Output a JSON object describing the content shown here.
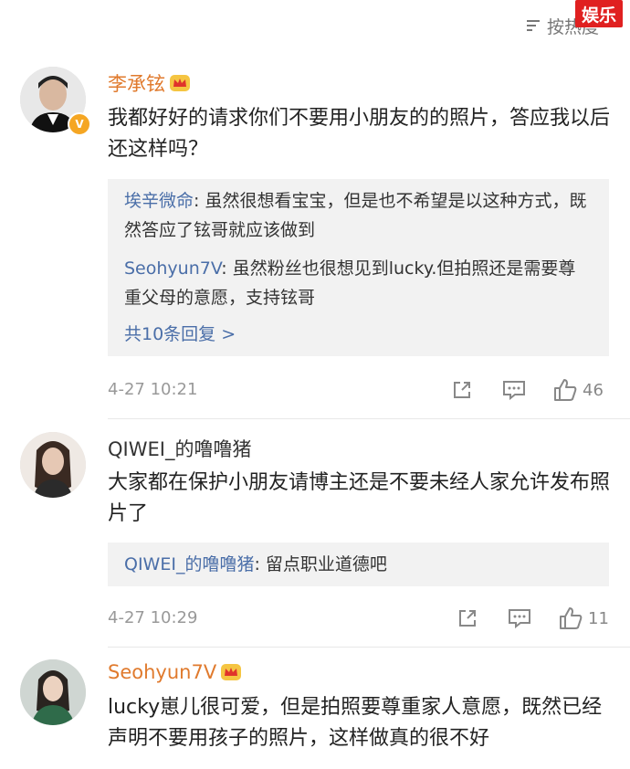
{
  "header": {
    "sort_label": "按热度",
    "sort_icon": "sort-lines-icon",
    "watermark": "娱乐"
  },
  "comments": [
    {
      "username": "李承铉",
      "vip": true,
      "verified": true,
      "text": "我都好好的请求你们不要用小朋友的的照片，答应我以后还这样吗？",
      "replies": [
        {
          "name": "埃辛微命",
          "text": "虽然很想看宝宝，但是也不希望是以这种方式，既然答应了铉哥就应该做到"
        },
        {
          "name": "Seohyun7V",
          "text": "虽然粉丝也很想见到lucky.但拍照还是需要尊重父母的意愿，支持铉哥"
        }
      ],
      "more_replies": "共10条回复 >",
      "time": "4-27 10:21",
      "likes": "46"
    },
    {
      "username": "QIWEI_的噜噜猪",
      "vip": false,
      "verified": false,
      "text": "大家都在保护小朋友请博主还是不要未经人家允许发布照片了",
      "replies": [
        {
          "name": "QIWEI_的噜噜猪",
          "text": "留点职业道德吧"
        }
      ],
      "time": "4-27 10:29",
      "likes": "11"
    },
    {
      "username": "Seohyun7V",
      "vip": true,
      "verified": false,
      "text": "lucky崽儿很可爱，但是拍照要尊重家人意愿，既然已经声明不要用孩子的照片，这样做真的很不好"
    }
  ],
  "colors": {
    "username": "#e07a2d",
    "reply_name": "#4a6ea8",
    "watermark": "#e02020",
    "badge": "#f5a623"
  }
}
